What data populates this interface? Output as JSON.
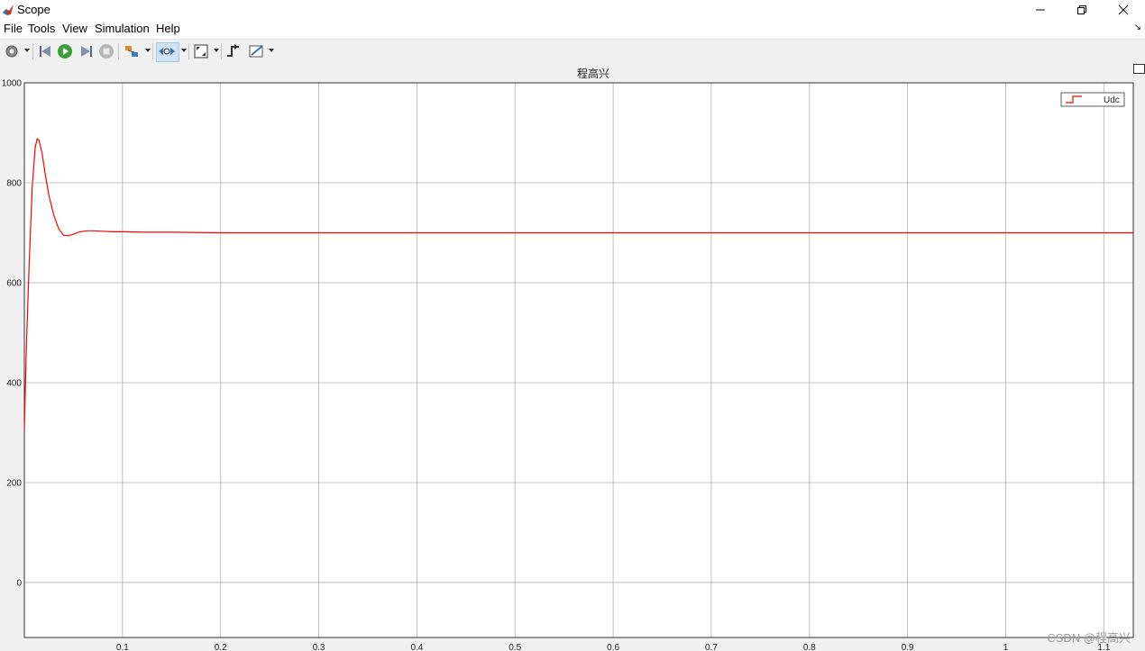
{
  "window": {
    "title": "Scope",
    "buttons": [
      "minimize",
      "restore",
      "close"
    ]
  },
  "menu": {
    "items": [
      "File",
      "Tools",
      "View",
      "Simulation",
      "Help"
    ]
  },
  "toolbar": {
    "icons": [
      "gear-icon",
      "step-back-icon",
      "run-icon",
      "step-forward-icon",
      "stop-icon",
      "highlight-icon",
      "zoom-icon",
      "autoscale-icon",
      "trigger-icon",
      "measure-icon"
    ]
  },
  "colors": {
    "series": "#ff0000",
    "axes_bg": "#ffffff",
    "grid": "#b0b0b0"
  },
  "watermark": "CSDN @程高兴",
  "chart_data": {
    "type": "line",
    "title": "程高兴",
    "xlabel": "",
    "ylabel": "",
    "xlim": [
      0,
      1.13
    ],
    "ylim": [
      -110,
      1000
    ],
    "x_ticks": [
      0.1,
      0.2,
      0.3,
      0.4,
      0.5,
      0.6,
      0.7,
      0.8,
      0.9,
      1,
      1.1
    ],
    "y_ticks": [
      0,
      200,
      400,
      600,
      800,
      1000
    ],
    "grid": true,
    "legend": "top-right",
    "series": [
      {
        "name": "Udc",
        "x": [
          0,
          0.002,
          0.005,
          0.008,
          0.011,
          0.013,
          0.015,
          0.018,
          0.021,
          0.025,
          0.03,
          0.035,
          0.04,
          0.045,
          0.05,
          0.055,
          0.06,
          0.065,
          0.07,
          0.08,
          0.09,
          0.1,
          0.12,
          0.15,
          0.2,
          0.3,
          0.4,
          0.5,
          0.6,
          0.7,
          0.8,
          0.9,
          1.0,
          1.1,
          1.13
        ],
        "y": [
          305,
          470,
          640,
          790,
          870,
          888,
          885,
          860,
          820,
          775,
          735,
          708,
          695,
          694,
          697,
          701,
          703,
          704,
          704,
          703,
          702,
          702,
          701,
          701,
          700,
          700,
          700,
          700,
          700,
          700,
          700,
          700,
          700,
          700,
          700
        ]
      }
    ]
  }
}
